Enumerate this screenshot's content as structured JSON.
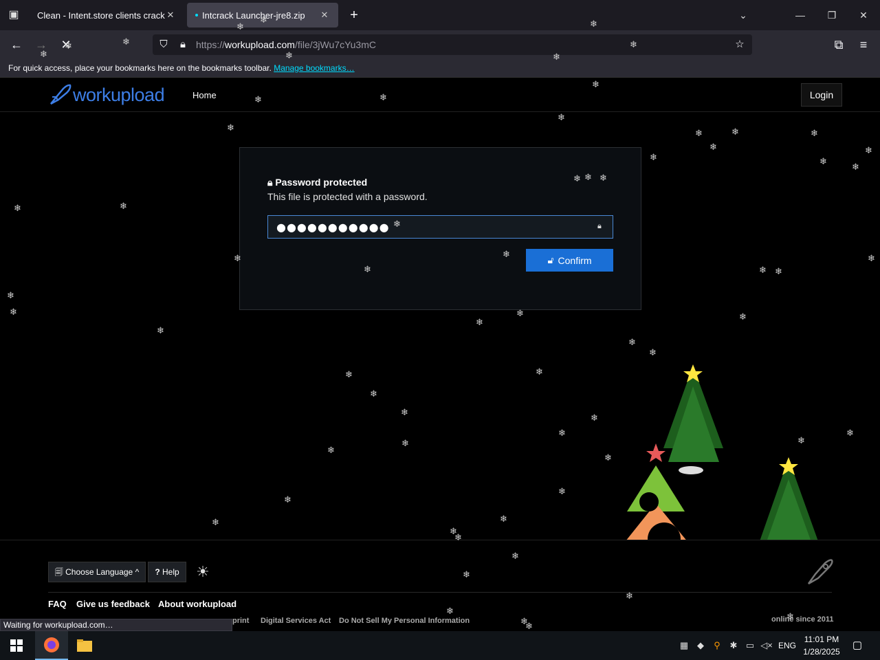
{
  "browser": {
    "tabs": [
      {
        "title": "Clean - Intent.store clients cracked",
        "active": false
      },
      {
        "title": "Intcrack Launcher-jre8.zip",
        "active": true,
        "loading": true
      }
    ],
    "url": {
      "scheme": "https://",
      "host": "workupload.com",
      "path": "/file/3jWu7cYu3mC"
    },
    "bookmarks_bar": {
      "text": "For quick access, place your bookmarks here on the bookmarks toolbar.",
      "link": "Manage bookmarks…"
    },
    "status_text": "Waiting for workupload.com…"
  },
  "site": {
    "logo": "workupload",
    "nav": {
      "home": "Home",
      "login": "Login"
    },
    "password_card": {
      "title": "Password protected",
      "subtitle": "This file is protected with a password.",
      "password_value": "●●●●●●●●●●●",
      "confirm_label": "Confirm"
    },
    "footer": {
      "language_button": "Choose Language",
      "help_button": "Help",
      "links": [
        "FAQ",
        "Give us feedback",
        "About workupload"
      ],
      "small_links": [
        "print",
        "Digital Services Act",
        "Do Not Sell My Personal Information"
      ],
      "online_since": "online since 2011"
    }
  },
  "taskbar": {
    "language": "ENG",
    "time": "11:01 PM",
    "date": "1/28/2025"
  },
  "colors": {
    "accent": "#1a6fd6",
    "logo": "#3d7ee6",
    "browser_bg": "#2b2a33",
    "page_bg": "#000000"
  }
}
